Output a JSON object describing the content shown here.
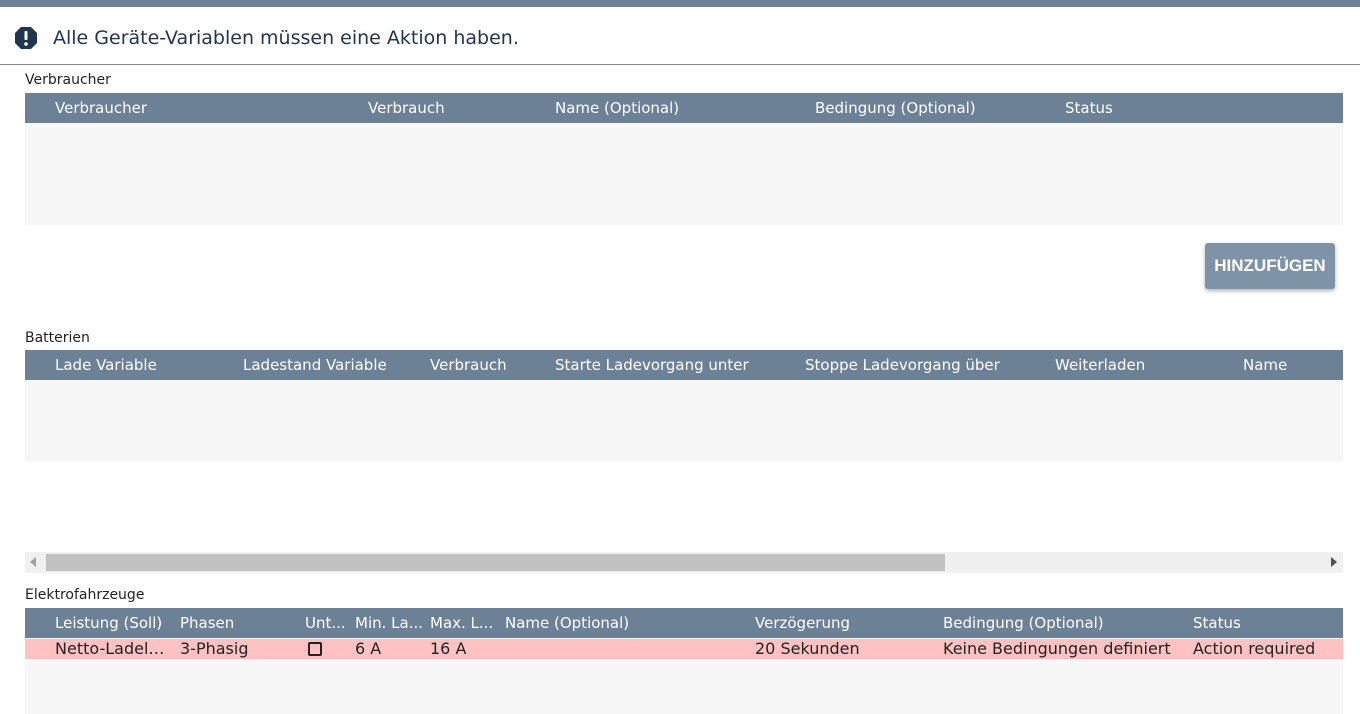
{
  "alert": {
    "icon": "exclamation-octagon-icon",
    "message": "Alle Geräte-Variablen müssen eine Aktion haben."
  },
  "verbraucher": {
    "label": "Verbraucher",
    "columns": [
      "Verbraucher",
      "Verbrauch",
      "Name (Optional)",
      "Bedingung (Optional)",
      "Status"
    ],
    "add_label": "HINZUFÜGEN"
  },
  "batterien": {
    "label": "Batterien",
    "columns": [
      "Lade Variable",
      "Ladestand Variable",
      "Verbrauch",
      "Starte Ladevorgang unter",
      "Stoppe Ladevorgang über",
      "Weiterladen",
      "Name"
    ]
  },
  "elektrofahrzeuge": {
    "label": "Elektrofahrzeuge",
    "columns": [
      "Leistung (Soll)",
      "Phasen",
      "Unt...",
      "Min. La...",
      "Max. L...",
      "Name (Optional)",
      "Verzögerung",
      "Bedingung (Optional)",
      "Status"
    ],
    "rows": [
      {
        "leistung": "Netto-Ladele...",
        "phasen": "3-Phasig",
        "min": "6 A",
        "max": "16 A",
        "name": "",
        "verzoegerung": "20 Sekunden",
        "bedingung": "Keine Bedingungen definiert",
        "status": "Action required"
      }
    ]
  },
  "colors": {
    "header": "#6c8196",
    "error_row": "#ffc2c2",
    "button": "#7f93a7",
    "alert_text": "#1f3550"
  }
}
